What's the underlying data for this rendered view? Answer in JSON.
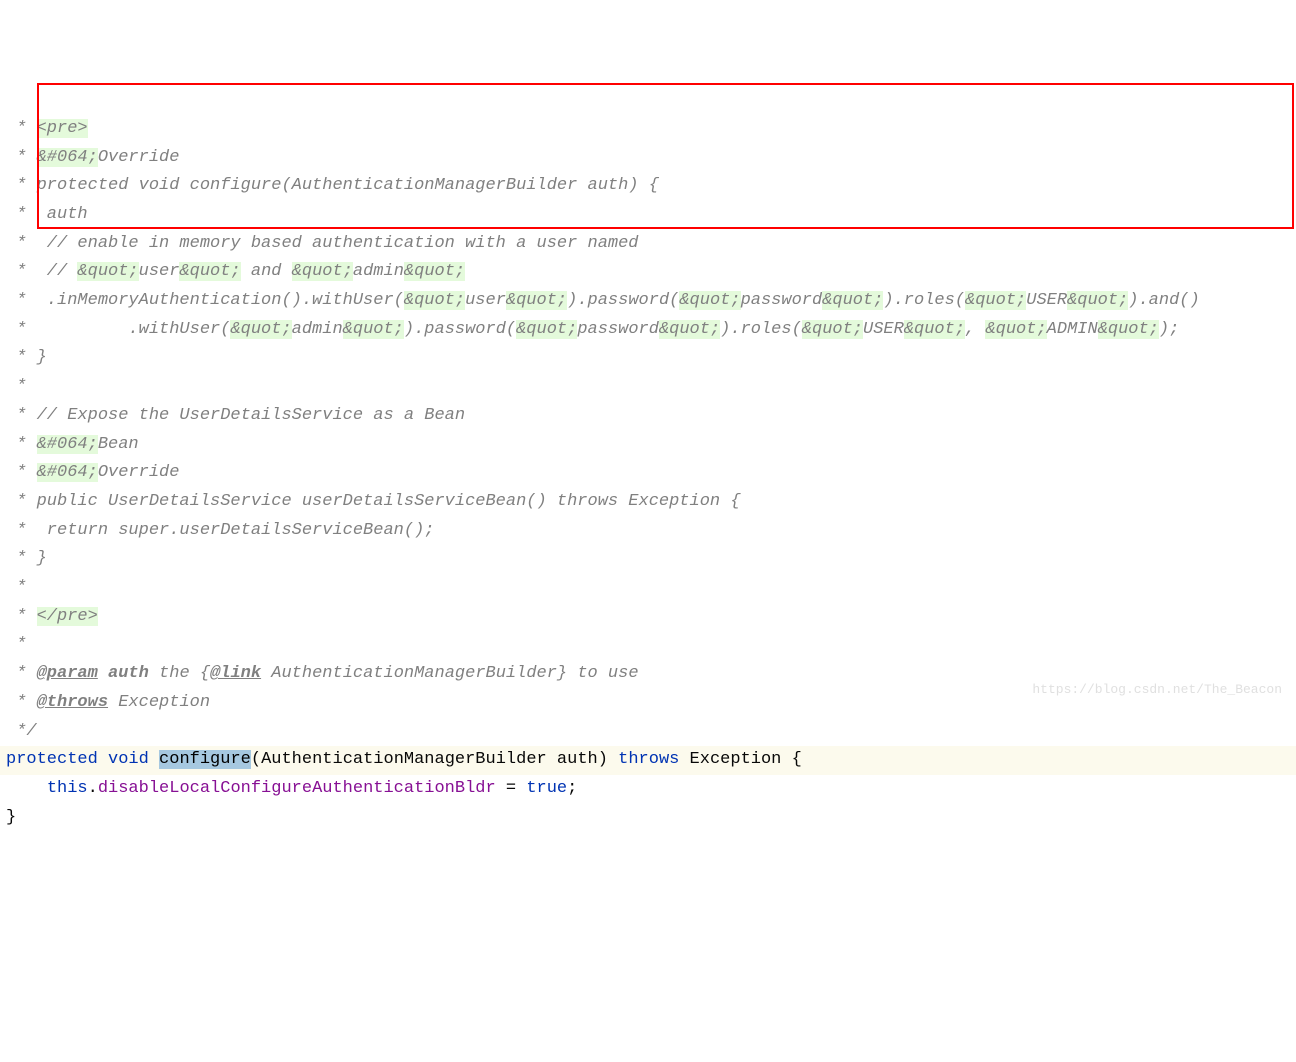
{
  "lines": {
    "l1": " * <pre>",
    "l2a": " * ",
    "l2b": "&#064;",
    "l2c": "Override",
    "l3": " * protected void configure(AuthenticationManagerBuilder auth) {",
    "l4": " *  auth",
    "l5": " *  // enable in memory based authentication with a user named",
    "l6a": " *  // ",
    "l6b": "&quot;",
    "l6c": "user",
    "l6d": "&quot;",
    "l6e": " and ",
    "l6f": "&quot;",
    "l6g": "admin",
    "l6h": "&quot;",
    "l7a": " *  .inMemoryAuthentication().withUser(",
    "l7b": "&quot;",
    "l7c": "user",
    "l7d": "&quot;",
    "l7e": ").password(",
    "l7f": "&quot;",
    "l7g": "password",
    "l7h": "&quot;",
    "l7i": ").roles(",
    "l7j": "&quot;",
    "l7k": "USER",
    "l7l": "&quot;",
    "l7m": ").and()",
    "l8a": " *          .withUser(",
    "l8b": "&quot;",
    "l8c": "admin",
    "l8d": "&quot;",
    "l8e": ").password(",
    "l8f": "&quot;",
    "l8g": "password",
    "l8h": "&quot;",
    "l8i": ").roles(",
    "l8j": "&quot;",
    "l8k": "USER",
    "l8l": "&quot;",
    "l8m": ", ",
    "l8n": "&quot;",
    "l8o": "ADMIN",
    "l8p": "&quot;",
    "l8q": ");",
    "l9": " * }",
    "l10": " *",
    "l11": " * // Expose the UserDetailsService as a Bean",
    "l12a": " * ",
    "l12b": "&#064;",
    "l12c": "Bean",
    "l13a": " * ",
    "l13b": "&#064;",
    "l13c": "Override",
    "l14": " * public UserDetailsService userDetailsServiceBean() throws Exception {",
    "l15": " *  return super.userDetailsServiceBean();",
    "l16": " * }",
    "l17": " *",
    "l18a": " * ",
    "l18b": "</pre>",
    "l19": " *",
    "l20a": " * ",
    "l20b": "@param",
    "l20c": " ",
    "l20d": "auth",
    "l20e": " the {",
    "l20f": "@link",
    "l20g": " AuthenticationManagerBuilder} to use",
    "l21a": " * ",
    "l21b": "@throws",
    "l21c": " Exception",
    "l22": " */",
    "l23a": "protected",
    "l23b": " ",
    "l23c": "void",
    "l23d": " ",
    "l23e": "configure",
    "l23f": "(AuthenticationManagerBuilder auth) ",
    "l23g": "throws",
    "l23h": " Exception {",
    "l24a": "    ",
    "l24b": "this",
    "l24c": ".",
    "l24d": "disableLocalConfigureAuthenticationBldr",
    "l24e": " = ",
    "l24f": "true",
    "l24g": ";",
    "l25": "}",
    "watermark": "https://blog.csdn.net/The_Beacon"
  }
}
